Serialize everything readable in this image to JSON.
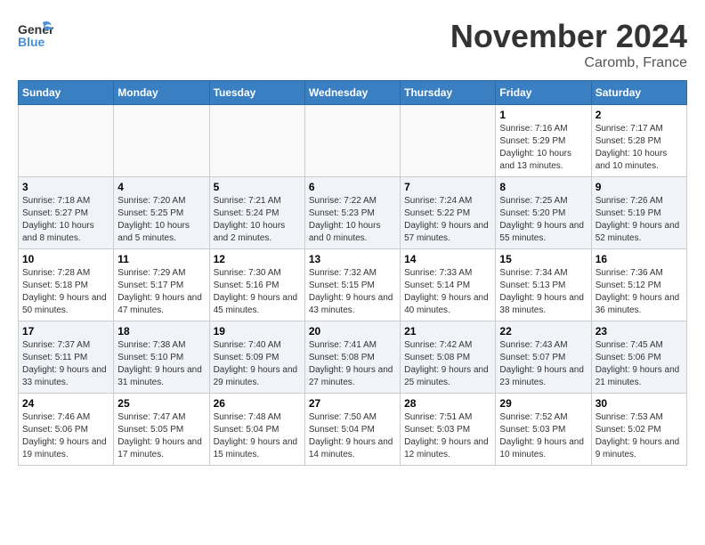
{
  "header": {
    "logo_line1": "General",
    "logo_line2": "Blue",
    "month_title": "November 2024",
    "location": "Caromb, France"
  },
  "weekdays": [
    "Sunday",
    "Monday",
    "Tuesday",
    "Wednesday",
    "Thursday",
    "Friday",
    "Saturday"
  ],
  "weeks": [
    [
      {
        "day": "",
        "info": ""
      },
      {
        "day": "",
        "info": ""
      },
      {
        "day": "",
        "info": ""
      },
      {
        "day": "",
        "info": ""
      },
      {
        "day": "",
        "info": ""
      },
      {
        "day": "1",
        "info": "Sunrise: 7:16 AM\nSunset: 5:29 PM\nDaylight: 10 hours and 13 minutes."
      },
      {
        "day": "2",
        "info": "Sunrise: 7:17 AM\nSunset: 5:28 PM\nDaylight: 10 hours and 10 minutes."
      }
    ],
    [
      {
        "day": "3",
        "info": "Sunrise: 7:18 AM\nSunset: 5:27 PM\nDaylight: 10 hours and 8 minutes."
      },
      {
        "day": "4",
        "info": "Sunrise: 7:20 AM\nSunset: 5:25 PM\nDaylight: 10 hours and 5 minutes."
      },
      {
        "day": "5",
        "info": "Sunrise: 7:21 AM\nSunset: 5:24 PM\nDaylight: 10 hours and 2 minutes."
      },
      {
        "day": "6",
        "info": "Sunrise: 7:22 AM\nSunset: 5:23 PM\nDaylight: 10 hours and 0 minutes."
      },
      {
        "day": "7",
        "info": "Sunrise: 7:24 AM\nSunset: 5:22 PM\nDaylight: 9 hours and 57 minutes."
      },
      {
        "day": "8",
        "info": "Sunrise: 7:25 AM\nSunset: 5:20 PM\nDaylight: 9 hours and 55 minutes."
      },
      {
        "day": "9",
        "info": "Sunrise: 7:26 AM\nSunset: 5:19 PM\nDaylight: 9 hours and 52 minutes."
      }
    ],
    [
      {
        "day": "10",
        "info": "Sunrise: 7:28 AM\nSunset: 5:18 PM\nDaylight: 9 hours and 50 minutes."
      },
      {
        "day": "11",
        "info": "Sunrise: 7:29 AM\nSunset: 5:17 PM\nDaylight: 9 hours and 47 minutes."
      },
      {
        "day": "12",
        "info": "Sunrise: 7:30 AM\nSunset: 5:16 PM\nDaylight: 9 hours and 45 minutes."
      },
      {
        "day": "13",
        "info": "Sunrise: 7:32 AM\nSunset: 5:15 PM\nDaylight: 9 hours and 43 minutes."
      },
      {
        "day": "14",
        "info": "Sunrise: 7:33 AM\nSunset: 5:14 PM\nDaylight: 9 hours and 40 minutes."
      },
      {
        "day": "15",
        "info": "Sunrise: 7:34 AM\nSunset: 5:13 PM\nDaylight: 9 hours and 38 minutes."
      },
      {
        "day": "16",
        "info": "Sunrise: 7:36 AM\nSunset: 5:12 PM\nDaylight: 9 hours and 36 minutes."
      }
    ],
    [
      {
        "day": "17",
        "info": "Sunrise: 7:37 AM\nSunset: 5:11 PM\nDaylight: 9 hours and 33 minutes."
      },
      {
        "day": "18",
        "info": "Sunrise: 7:38 AM\nSunset: 5:10 PM\nDaylight: 9 hours and 31 minutes."
      },
      {
        "day": "19",
        "info": "Sunrise: 7:40 AM\nSunset: 5:09 PM\nDaylight: 9 hours and 29 minutes."
      },
      {
        "day": "20",
        "info": "Sunrise: 7:41 AM\nSunset: 5:08 PM\nDaylight: 9 hours and 27 minutes."
      },
      {
        "day": "21",
        "info": "Sunrise: 7:42 AM\nSunset: 5:08 PM\nDaylight: 9 hours and 25 minutes."
      },
      {
        "day": "22",
        "info": "Sunrise: 7:43 AM\nSunset: 5:07 PM\nDaylight: 9 hours and 23 minutes."
      },
      {
        "day": "23",
        "info": "Sunrise: 7:45 AM\nSunset: 5:06 PM\nDaylight: 9 hours and 21 minutes."
      }
    ],
    [
      {
        "day": "24",
        "info": "Sunrise: 7:46 AM\nSunset: 5:06 PM\nDaylight: 9 hours and 19 minutes."
      },
      {
        "day": "25",
        "info": "Sunrise: 7:47 AM\nSunset: 5:05 PM\nDaylight: 9 hours and 17 minutes."
      },
      {
        "day": "26",
        "info": "Sunrise: 7:48 AM\nSunset: 5:04 PM\nDaylight: 9 hours and 15 minutes."
      },
      {
        "day": "27",
        "info": "Sunrise: 7:50 AM\nSunset: 5:04 PM\nDaylight: 9 hours and 14 minutes."
      },
      {
        "day": "28",
        "info": "Sunrise: 7:51 AM\nSunset: 5:03 PM\nDaylight: 9 hours and 12 minutes."
      },
      {
        "day": "29",
        "info": "Sunrise: 7:52 AM\nSunset: 5:03 PM\nDaylight: 9 hours and 10 minutes."
      },
      {
        "day": "30",
        "info": "Sunrise: 7:53 AM\nSunset: 5:02 PM\nDaylight: 9 hours and 9 minutes."
      }
    ]
  ]
}
